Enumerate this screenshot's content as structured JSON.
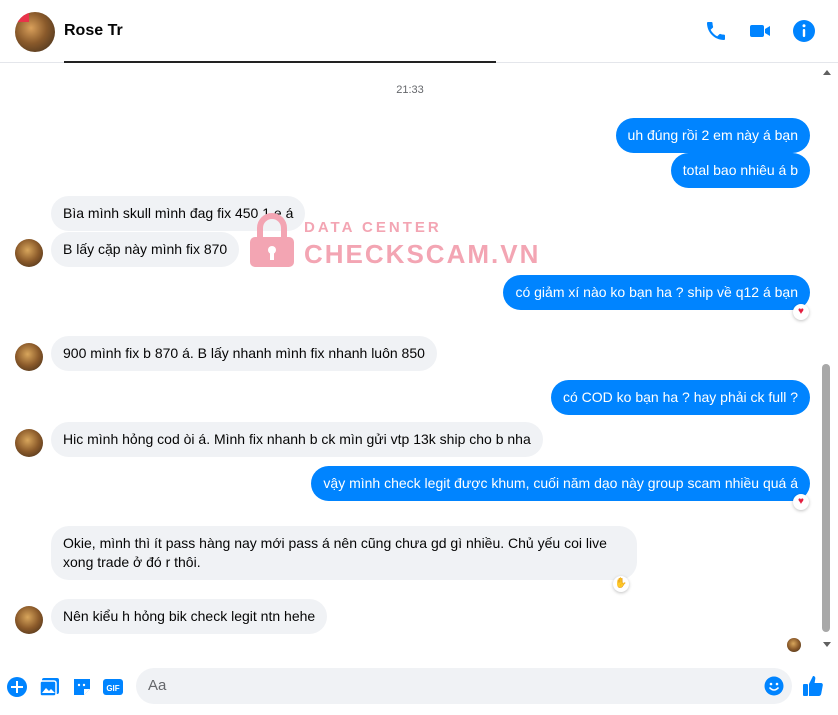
{
  "header": {
    "contact_name": "Rose Tr",
    "icons": [
      "phone-icon",
      "video-icon",
      "info-icon"
    ]
  },
  "chat": {
    "timestamp": "21:33",
    "messages": [
      {
        "side": "out",
        "text": "uh đúng rồi 2 em này á bạn"
      },
      {
        "side": "out",
        "text": "total  bao  nhiêu á b"
      },
      {
        "side": "in",
        "text": "Bìa mình skull mình đag fix 450 1 e á"
      },
      {
        "side": "in",
        "text": "B lấy cặp này mình fix 870"
      },
      {
        "side": "out",
        "text": "có giảm xí nào ko bạn ha ? ship về q12 á bạn",
        "reaction": "heart"
      },
      {
        "side": "in",
        "text": "900 mình fix b 870 á. B lấy nhanh mình fix nhanh luôn 850"
      },
      {
        "side": "out",
        "text": "có COD ko bạn ha ? hay phải ck full ?"
      },
      {
        "side": "in",
        "text": "Hic mình hỏng cod òi á. Mình fix nhanh b ck mìn gửi vtp 13k ship cho b nha"
      },
      {
        "side": "out",
        "text": "vậy mình check legit được khum, cuối năm dạo này group scam nhiều quá á",
        "reaction": "heart"
      },
      {
        "side": "in",
        "text": "Okie, mình thì ít pass hàng nay mới pass á nên cũng chưa gd gì nhiều. Chủ yếu coi live xong trade ở đó r thôi.",
        "reaction": "ok"
      },
      {
        "side": "in",
        "text": "Nên kiểu h hỏng bik check legit ntn hehe"
      }
    ]
  },
  "watermark": {
    "top": "DATA CENTER",
    "main": "CHECKSCAM.VN"
  },
  "composer": {
    "placeholder": "Aa",
    "icons": [
      "plus-icon",
      "image-icon",
      "sticker-icon",
      "gif-icon",
      "emoji-icon",
      "like-icon"
    ],
    "gif_label": "GIF"
  },
  "colors": {
    "accent": "#0084ff",
    "incoming_bubble": "#f0f2f5",
    "watermark": "#f3a5b3"
  }
}
